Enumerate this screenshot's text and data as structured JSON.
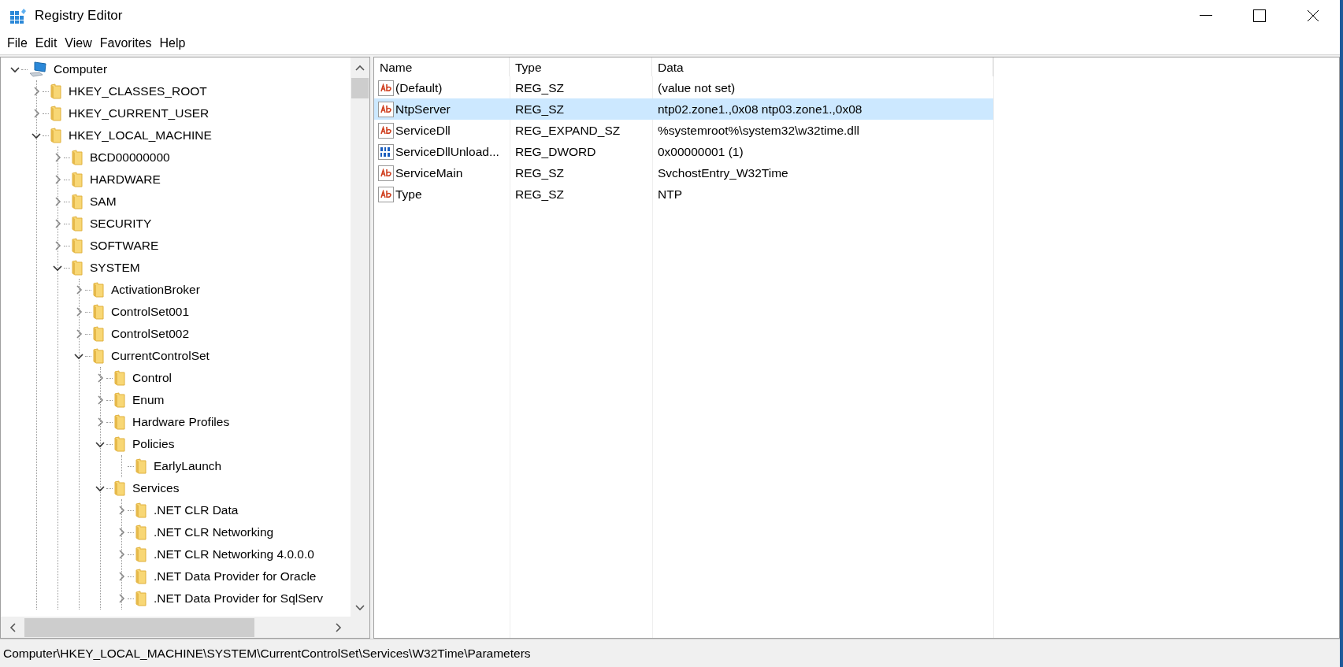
{
  "window": {
    "title": "Registry Editor"
  },
  "menu": [
    "File",
    "Edit",
    "View",
    "Favorites",
    "Help"
  ],
  "tree": [
    {
      "label": "Computer",
      "kind": "computer",
      "expanded": true,
      "children": [
        {
          "label": "HKEY_CLASSES_ROOT",
          "kind": "folder",
          "expanded": false
        },
        {
          "label": "HKEY_CURRENT_USER",
          "kind": "folder",
          "expanded": false
        },
        {
          "label": "HKEY_LOCAL_MACHINE",
          "kind": "folder",
          "expanded": true,
          "children": [
            {
              "label": "BCD00000000",
              "kind": "folder",
              "expanded": false
            },
            {
              "label": "HARDWARE",
              "kind": "folder",
              "expanded": false
            },
            {
              "label": "SAM",
              "kind": "folder",
              "expanded": false
            },
            {
              "label": "SECURITY",
              "kind": "folder",
              "expanded": false
            },
            {
              "label": "SOFTWARE",
              "kind": "folder",
              "expanded": false
            },
            {
              "label": "SYSTEM",
              "kind": "folder",
              "expanded": true,
              "children": [
                {
                  "label": "ActivationBroker",
                  "kind": "folder",
                  "expanded": false
                },
                {
                  "label": "ControlSet001",
                  "kind": "folder",
                  "expanded": false
                },
                {
                  "label": "ControlSet002",
                  "kind": "folder",
                  "expanded": false
                },
                {
                  "label": "CurrentControlSet",
                  "kind": "folder",
                  "expanded": true,
                  "children": [
                    {
                      "label": "Control",
                      "kind": "folder",
                      "expanded": false
                    },
                    {
                      "label": "Enum",
                      "kind": "folder",
                      "expanded": false
                    },
                    {
                      "label": "Hardware Profiles",
                      "kind": "folder",
                      "expanded": false
                    },
                    {
                      "label": "Policies",
                      "kind": "folder",
                      "expanded": true,
                      "children": [
                        {
                          "label": "EarlyLaunch",
                          "kind": "folder"
                        }
                      ]
                    },
                    {
                      "label": "Services",
                      "kind": "folder",
                      "expanded": true,
                      "children": [
                        {
                          "label": ".NET CLR Data",
                          "kind": "folder",
                          "expanded": false
                        },
                        {
                          "label": ".NET CLR Networking",
                          "kind": "folder",
                          "expanded": false
                        },
                        {
                          "label": ".NET CLR Networking 4.0.0.0",
                          "kind": "folder",
                          "expanded": false
                        },
                        {
                          "label": ".NET Data Provider for Oracle",
                          "kind": "folder",
                          "expanded": false
                        },
                        {
                          "label": ".NET Data Provider for SqlServ",
                          "kind": "folder",
                          "expanded": false
                        }
                      ]
                    }
                  ]
                }
              ]
            }
          ]
        }
      ]
    }
  ],
  "table": {
    "columns": [
      "Name",
      "Type",
      "Data"
    ],
    "rows": [
      {
        "name": "(Default)",
        "type": "REG_SZ",
        "data": "(value not set)",
        "kind": "string",
        "selected": false
      },
      {
        "name": "NtpServer",
        "type": "REG_SZ",
        "data": "ntp02.zone1.,0x08 ntp03.zone1.,0x08",
        "kind": "string",
        "selected": true
      },
      {
        "name": "ServiceDll",
        "type": "REG_EXPAND_SZ",
        "data": "%systemroot%\\system32\\w32time.dll",
        "kind": "string",
        "selected": false
      },
      {
        "name": "ServiceDllUnload...",
        "type": "REG_DWORD",
        "data": "0x00000001 (1)",
        "kind": "binary",
        "selected": false
      },
      {
        "name": "ServiceMain",
        "type": "REG_SZ",
        "data": "SvchostEntry_W32Time",
        "kind": "string",
        "selected": false
      },
      {
        "name": "Type",
        "type": "REG_SZ",
        "data": "NTP",
        "kind": "string",
        "selected": false
      }
    ]
  },
  "status_bar": "Computer\\HKEY_LOCAL_MACHINE\\SYSTEM\\CurrentControlSet\\Services\\W32Time\\Parameters"
}
